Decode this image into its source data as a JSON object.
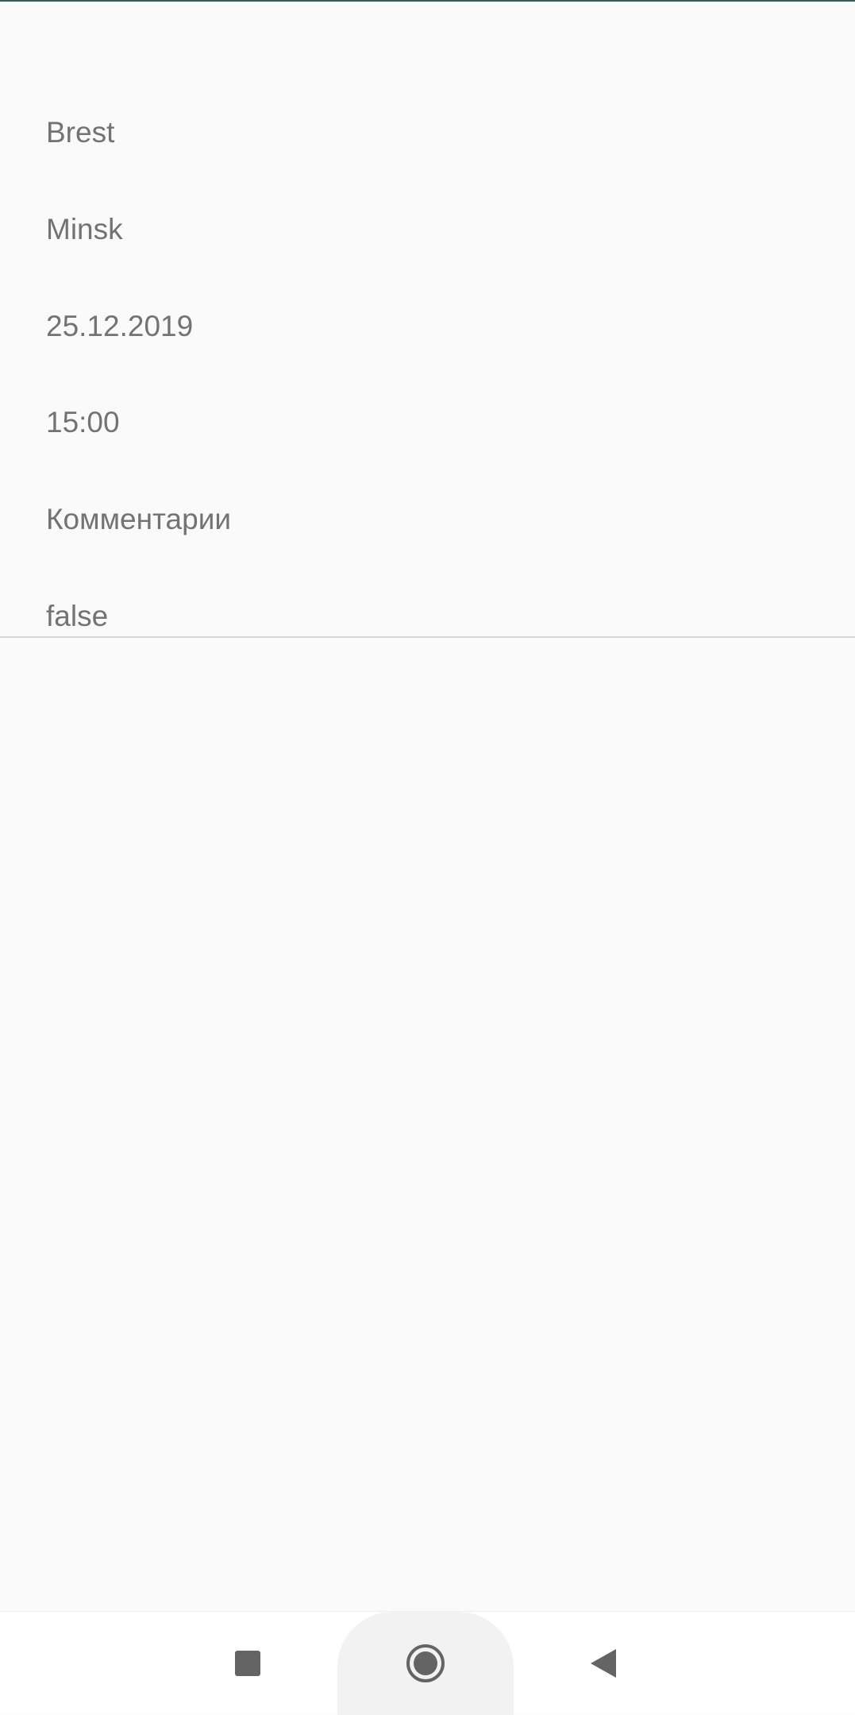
{
  "trip": {
    "from": "Brest",
    "to": "Minsk",
    "date": "25.12.2019",
    "time": "15:00",
    "comment": "Комментарии",
    "flag": "false"
  },
  "colors": {
    "background": "#fafafa",
    "text": "#737373",
    "accent": "#2e5e57",
    "divider": "#d6d6d6",
    "nav_icon": "#646464"
  },
  "navigation": {
    "recents_icon": "square-recents-icon",
    "home_icon": "circle-home-icon",
    "back_icon": "triangle-back-icon"
  }
}
